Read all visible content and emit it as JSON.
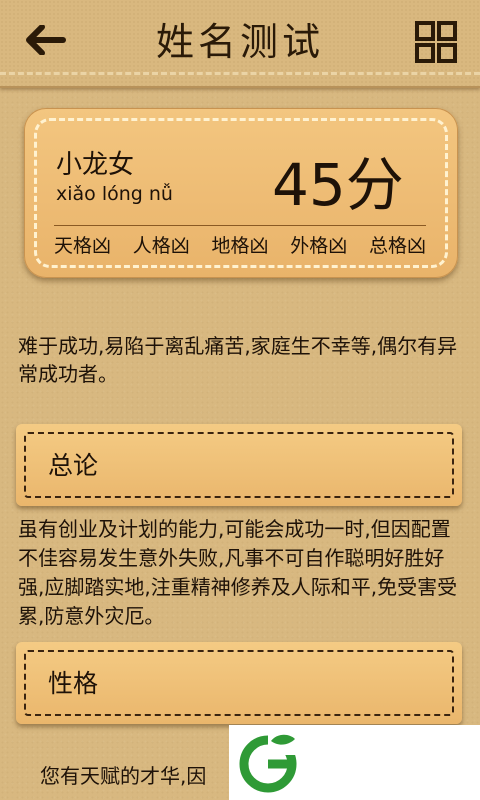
{
  "header": {
    "title": "姓名测试",
    "back_icon": "back-arrow-icon",
    "menu_icon": "grid-menu-icon"
  },
  "result": {
    "name": "小龙女",
    "pinyin": "xiǎo lóng nǚ",
    "score": "45分",
    "ges": [
      "天格凶",
      "人格凶",
      "地格凶",
      "外格凶",
      "总格凶"
    ]
  },
  "summary": "难于成功,易陷于离乱痛苦,家庭生不幸等,偶尔有异常成功者。",
  "sections": [
    {
      "label": "总论",
      "text": "虽有创业及计划的能力,可能会成功一时,但因配置不佳容易发生意外失败,凡事不可自作聪明好胜好强,应脚踏实地,注重精神修养及人际和平,免受害受累,防意外灾厄。"
    },
    {
      "label": "性格",
      "text": "您有天赋的才华,因"
    }
  ],
  "colors": {
    "background": "#d8b880",
    "card": "#eeb978",
    "text": "#1e1208",
    "logo_green": "#2f9a36"
  },
  "logo_icon": "green-g-logo-icon"
}
